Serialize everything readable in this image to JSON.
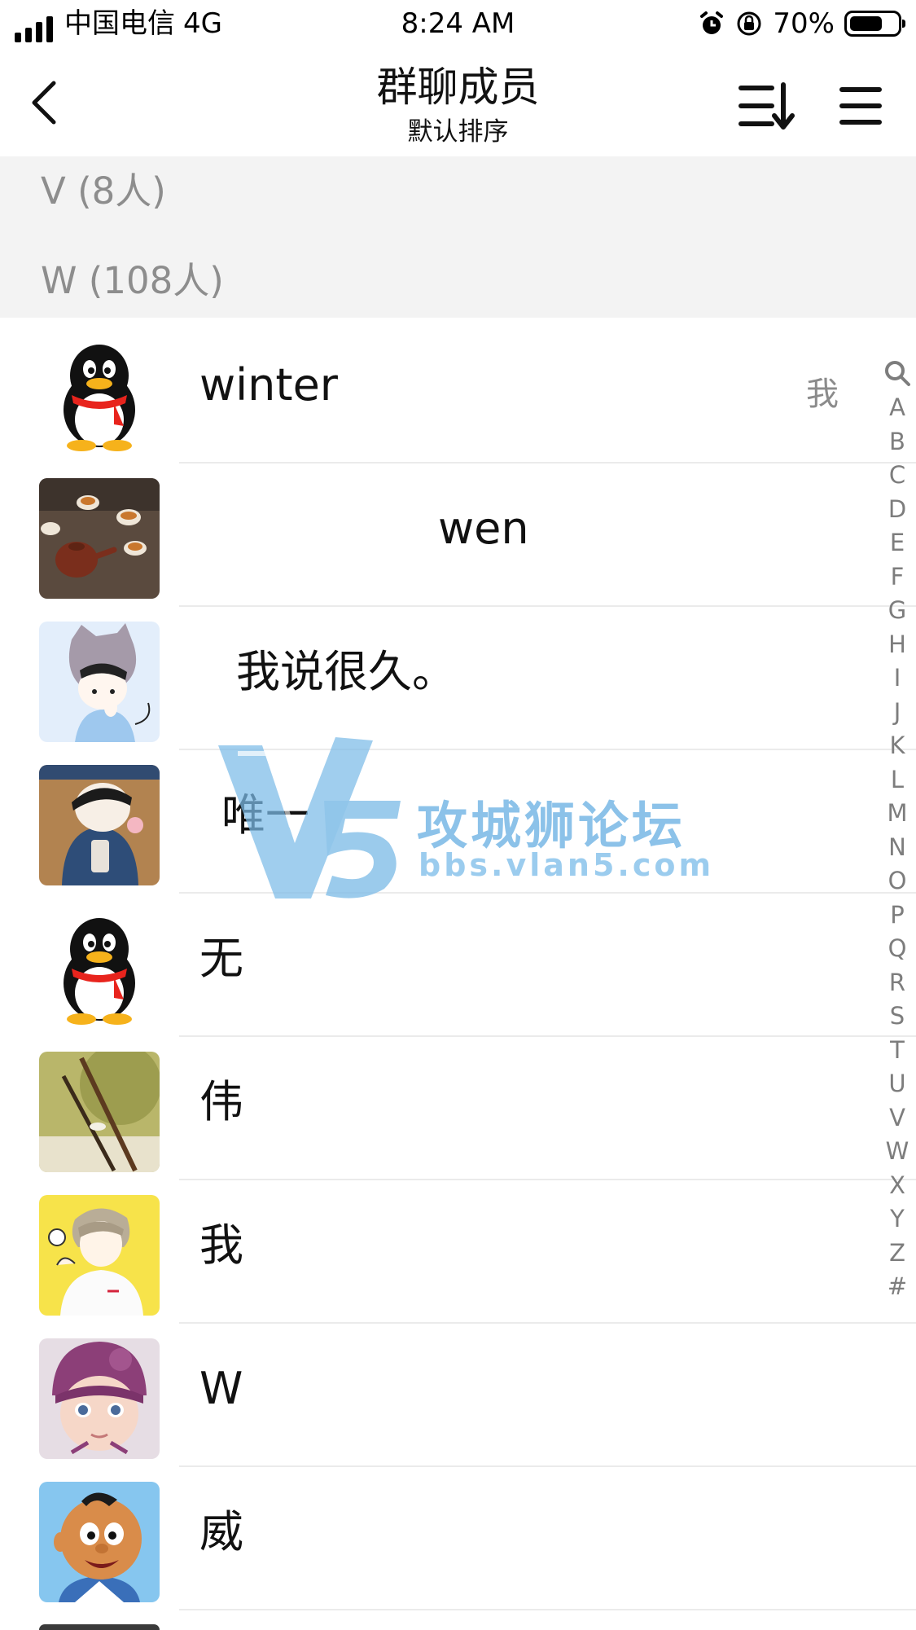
{
  "status_bar": {
    "carrier": "中国电信",
    "network": "4G",
    "time": "8:24 AM",
    "battery_pct": "70%",
    "battery_level": 0.7
  },
  "nav": {
    "title": "群聊成员",
    "subtitle": "默认排序"
  },
  "sections": [
    {
      "label": "V (8人)"
    },
    {
      "label": "W (108人)"
    }
  ],
  "members": [
    {
      "name": "winter",
      "tag": "我",
      "avatar": "qq-penguin"
    },
    {
      "name": "wen",
      "avatar": "tea-set-photo"
    },
    {
      "name": "我说很久。",
      "avatar": "cartoon-child"
    },
    {
      "name": "唯一",
      "avatar": "cartoon-boy-cap"
    },
    {
      "name": "无",
      "avatar": "qq-penguin"
    },
    {
      "name": "伟",
      "avatar": "brush-pen-photo"
    },
    {
      "name": "我",
      "avatar": "anime-boy-yellow"
    },
    {
      "name": "W",
      "avatar": "baby-purple-hat"
    },
    {
      "name": "威",
      "avatar": "cartoon-bald-boy"
    }
  ],
  "index_bar": [
    "A",
    "B",
    "C",
    "D",
    "E",
    "F",
    "G",
    "H",
    "I",
    "J",
    "K",
    "L",
    "M",
    "N",
    "O",
    "P",
    "Q",
    "R",
    "S",
    "T",
    "U",
    "V",
    "W",
    "X",
    "Y",
    "Z",
    "#"
  ],
  "watermark": {
    "title": "攻城狮论坛",
    "url": "bbs.vlan5.com"
  },
  "icons": {
    "back": "chevron-left-icon",
    "sort": "sort-icon",
    "menu": "menu-icon",
    "index_search": "search-icon"
  }
}
